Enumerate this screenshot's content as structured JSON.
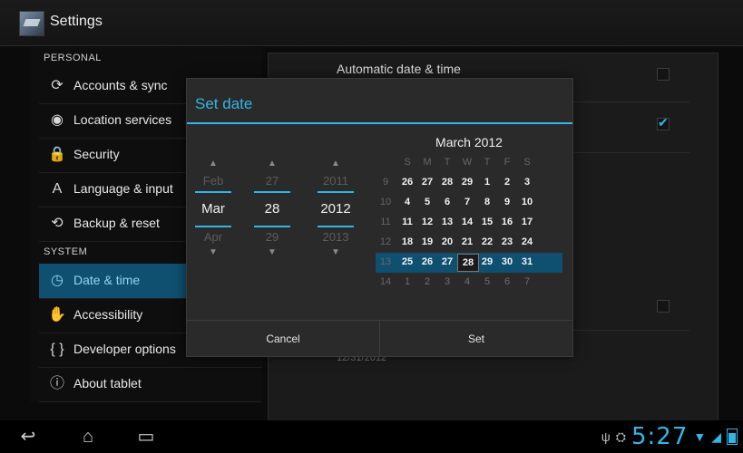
{
  "app": {
    "title": "Settings",
    "icon": "settings-icon"
  },
  "sidebar": {
    "sections": [
      {
        "title": "PERSONAL"
      },
      {
        "title": "SYSTEM"
      }
    ],
    "items": [
      {
        "label": "Accounts & sync",
        "icon": "sync-icon"
      },
      {
        "label": "Location services",
        "icon": "location-icon"
      },
      {
        "label": "Security",
        "icon": "lock-icon"
      },
      {
        "label": "Language & input",
        "icon": "keyboard-icon"
      },
      {
        "label": "Backup & reset",
        "icon": "backup-icon"
      },
      {
        "label": "Date & time",
        "icon": "clock-icon",
        "selected": true
      },
      {
        "label": "Accessibility",
        "icon": "hand-icon"
      },
      {
        "label": "Developer options",
        "icon": "braces-icon"
      },
      {
        "label": "About tablet",
        "icon": "info-icon"
      }
    ]
  },
  "content": {
    "automatic_date_time": "Automatic date & time",
    "date_value": "12/31/2012",
    "checkbox1_checked": false,
    "checkbox2_checked": true,
    "checkbox3_checked": false
  },
  "dialog": {
    "title": "Set date",
    "spinners": {
      "month": {
        "prev": "Feb",
        "cur": "Mar",
        "next": "Apr"
      },
      "day": {
        "prev": "27",
        "cur": "28",
        "next": "29"
      },
      "year": {
        "prev": "2011",
        "cur": "2012",
        "next": "2013"
      }
    },
    "calendar": {
      "month_label": "March 2012",
      "weekdays": [
        "S",
        "M",
        "T",
        "W",
        "T",
        "F",
        "S"
      ],
      "rows": [
        {
          "week": "9",
          "days": [
            "26",
            "27",
            "28",
            "29",
            "1",
            "2",
            "3"
          ]
        },
        {
          "week": "10",
          "days": [
            "4",
            "5",
            "6",
            "7",
            "8",
            "9",
            "10"
          ]
        },
        {
          "week": "11",
          "days": [
            "11",
            "12",
            "13",
            "14",
            "15",
            "16",
            "17"
          ]
        },
        {
          "week": "12",
          "days": [
            "18",
            "19",
            "20",
            "21",
            "22",
            "23",
            "24"
          ]
        },
        {
          "week": "13",
          "days": [
            "25",
            "26",
            "27",
            "28",
            "29",
            "30",
            "31"
          ]
        },
        {
          "week": "14",
          "days": [
            "1",
            "2",
            "3",
            "4",
            "5",
            "6",
            "7"
          ]
        }
      ],
      "selected_day": "28"
    },
    "buttons": {
      "cancel": "Cancel",
      "set": "Set"
    }
  },
  "status": {
    "time": "5:27"
  },
  "colors": {
    "accent": "#33b5e5",
    "selected_bg": "#0f5071"
  }
}
